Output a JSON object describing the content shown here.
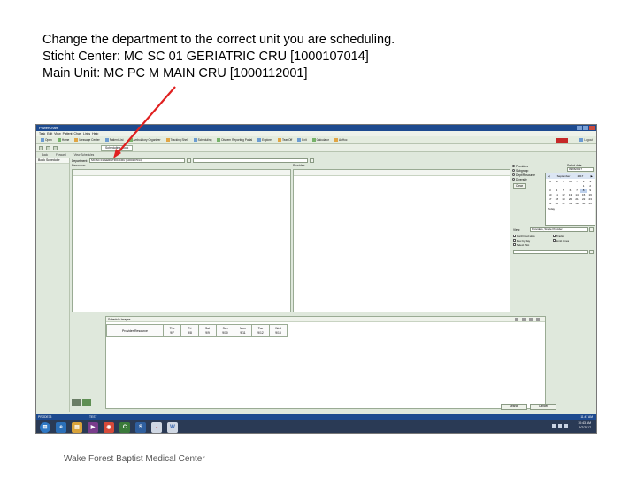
{
  "slide": {
    "line1": "Change the department to the correct unit you are scheduling.",
    "line2": "Sticht Center: MC SC 01 GERIATRIC CRU [1000107014]",
    "line3": "Main Unit: MC PC M MAIN CRU [1000112001]",
    "footer": "Wake Forest Baptist Medical Center"
  },
  "app": {
    "title": "PowerChart",
    "menu": [
      "Task",
      "Edit",
      "View",
      "Patient",
      "Chart",
      "Links",
      "Help"
    ],
    "toolbar": [
      "Open",
      "Home",
      "Message Center",
      "Patient List",
      "Ambulatory Organizer",
      "Tracking Shell",
      "Scheduling",
      "Discern Reporting Portal",
      "Explorer",
      "Tear Off",
      "Exit",
      "Calculator",
      "AdHoc"
    ],
    "logout": "Logout",
    "tab_label": "Scheduling Book",
    "nav": {
      "back": "Back",
      "forward": "Forward",
      "title": "View Schedules"
    },
    "left_nav": [
      "Book Scheduler"
    ],
    "department_label": "Department:",
    "department_value": "MC SC 01 GERIATRIC CRU [1000107014]",
    "resource_label": "Resource:",
    "provider_label": "Provider:",
    "view_options": [
      "Providers",
      "Subgroup",
      "Dept/Resource",
      "Diversity"
    ],
    "clear_label": "Clear",
    "select_date_label": "Select date",
    "date_value": "09/06/2017",
    "calendar": {
      "month": "September",
      "year": "2017",
      "days": [
        "S",
        "M",
        "T",
        "W",
        "T",
        "F",
        "S"
      ],
      "dates": [
        "",
        "",
        "",
        "",
        "",
        "1",
        "2",
        "3",
        "4",
        "5",
        "6",
        "7",
        "8",
        "9",
        "10",
        "11",
        "12",
        "13",
        "14",
        "15",
        "16",
        "17",
        "18",
        "19",
        "20",
        "21",
        "22",
        "23",
        "24",
        "25",
        "26",
        "27",
        "28",
        "29",
        "30"
      ],
      "today_label": "Today"
    },
    "view_label": "View:",
    "view_value": "Providers, Single Provider",
    "checkboxes": [
      "Confirmed slots",
      "Flex by day",
      "Select Slot",
      "Tracks",
      "Limit times"
    ],
    "schedule_header": "Schedule Images",
    "schedule_first_col": "Provider/Resource",
    "schedule_days": [
      {
        "day": "Thu",
        "date": "9/7"
      },
      {
        "day": "Fri",
        "date": "9/8"
      },
      {
        "day": "Sat",
        "date": "9/9"
      },
      {
        "day": "Sun",
        "date": "9/10"
      },
      {
        "day": "Mon",
        "date": "9/11"
      },
      {
        "day": "Tue",
        "date": "9/12"
      },
      {
        "day": "Wed",
        "date": "9/13"
      }
    ],
    "search_btn": "Search",
    "cancel_btn": "Cancel",
    "status_left": "PRODE73",
    "status_mid": "TEST",
    "status_right": "11:47 AM",
    "tray_time": "10:43 AM",
    "tray_date": "9/7/2017"
  },
  "colors": {
    "arrow": "#e02020",
    "title_bar": "#1d4a8f",
    "taskbar": "#2a3a55"
  }
}
